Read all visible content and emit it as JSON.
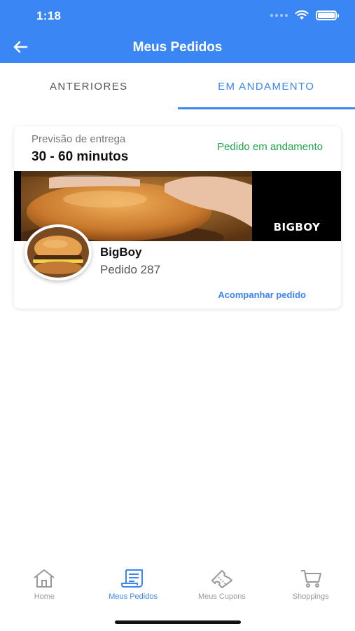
{
  "status_bar": {
    "time": "1:18"
  },
  "header": {
    "title": "Meus Pedidos"
  },
  "tabs": [
    {
      "label": "ANTERIORES",
      "active": false
    },
    {
      "label": "EM ANDAMENTO",
      "active": true
    }
  ],
  "order": {
    "eta_label": "Previsão de entrega",
    "eta_value": "30 - 60 minutos",
    "status": "Pedido em andamento",
    "store_name": "BigBoy",
    "order_number": "Pedido 287",
    "track_label": "Acompanhar pedido",
    "banner_logo": "BIGBOY"
  },
  "bottom_nav": [
    {
      "label": "Home",
      "icon": "home-icon",
      "active": false
    },
    {
      "label": "Meus Pedidos",
      "icon": "receipt-icon",
      "active": true
    },
    {
      "label": "Meus Cupons",
      "icon": "ticket-icon",
      "active": false
    },
    {
      "label": "Shoppings",
      "icon": "cart-icon",
      "active": false
    }
  ],
  "colors": {
    "primary": "#3a86f5",
    "status_green": "#1fa64a",
    "inactive": "#999999"
  }
}
